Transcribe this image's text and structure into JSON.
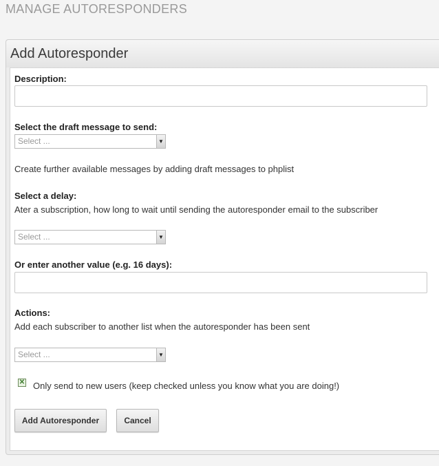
{
  "page_title": "MANAGE AUTORESPONDERS",
  "panel": {
    "title": "Add Autoresponder"
  },
  "form": {
    "description_label": "Description:",
    "description_value": "",
    "draft_label": "Select the draft message to send:",
    "draft_select_value": "Select ...",
    "draft_hint": "Create further available messages by adding draft messages to phplist",
    "delay_label": "Select a delay:",
    "delay_hint": "Ater a subscription, how long to wait until sending the autoresponder email to the subscriber",
    "delay_select_value": "Select ...",
    "other_value_label": "Or enter another value (e.g. 16 days):",
    "other_value": "",
    "actions_label": "Actions:",
    "actions_hint": "Add each subscriber to another list when the autoresponder has been sent",
    "actions_select_value": "Select ...",
    "new_users_checkbox_checked": true,
    "new_users_checkbox_label": "Only send to new users (keep checked unless you know what you are doing!)",
    "submit_label": "Add Autoresponder",
    "cancel_label": "Cancel"
  },
  "icons": {
    "select_arrow": "dropdown-arrow-icon",
    "checkbox_mark": "checkmark-icon"
  }
}
